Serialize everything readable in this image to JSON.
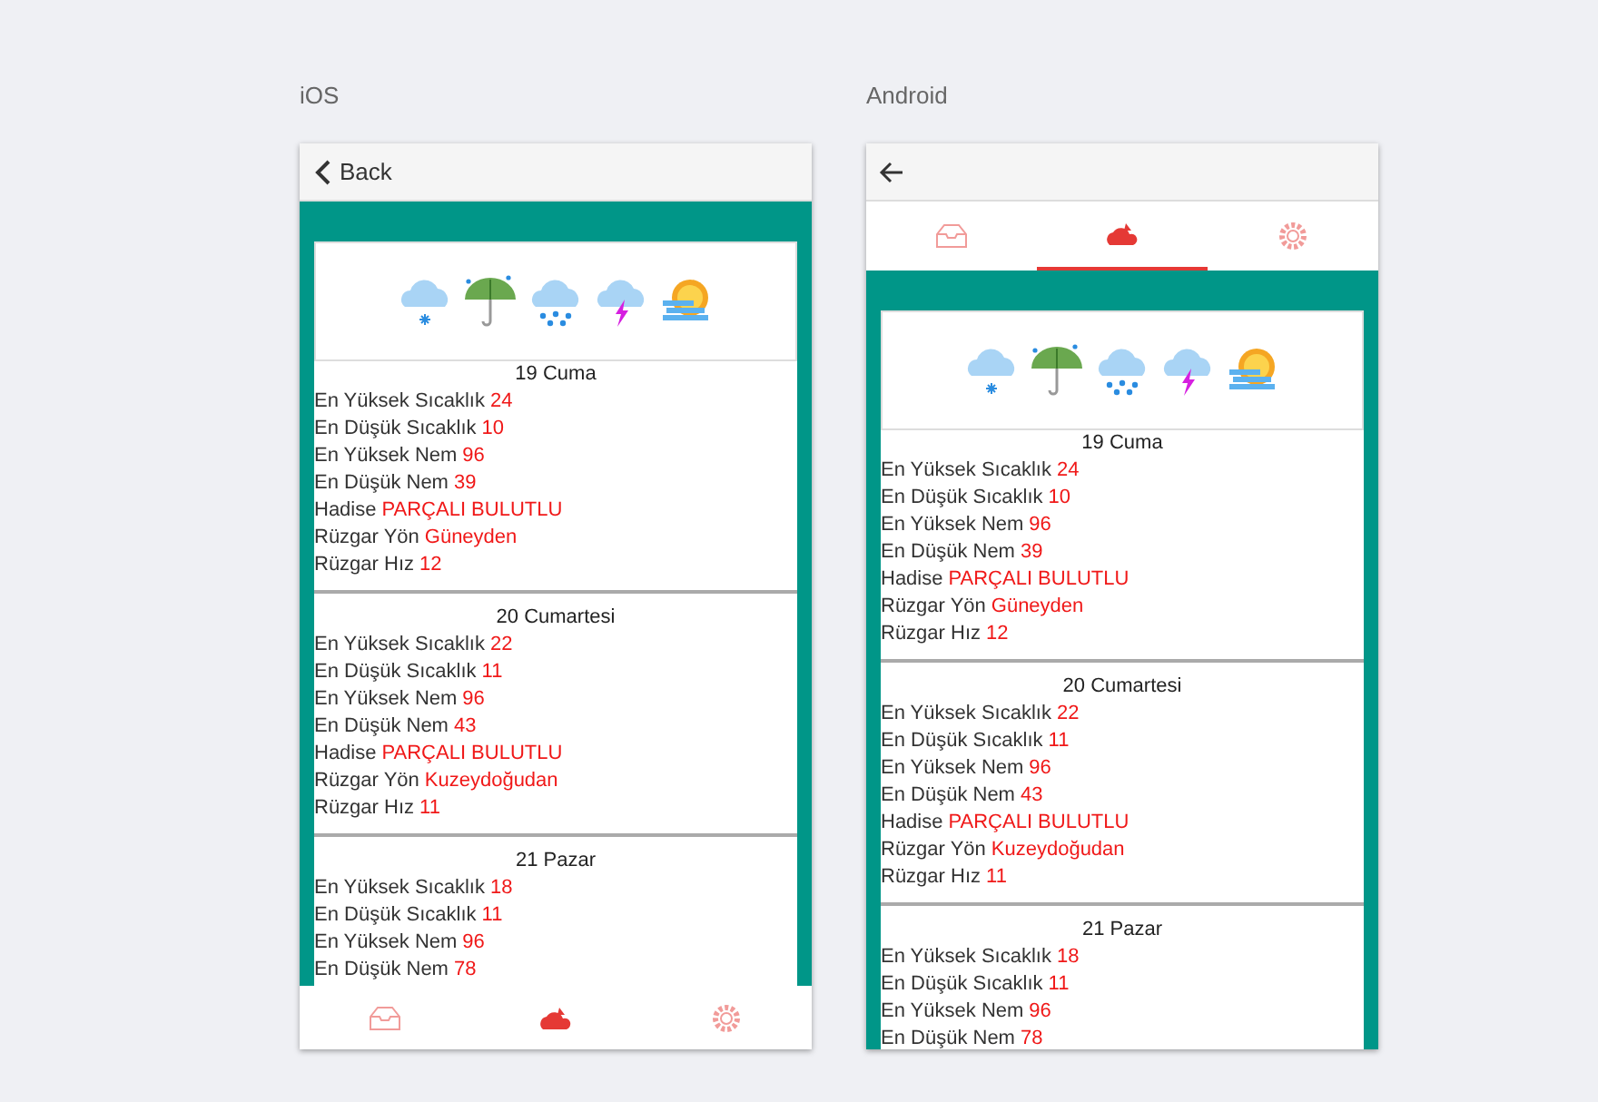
{
  "phones": [
    {
      "kind": "ios",
      "platform_label": "iOS",
      "back_label": "Back",
      "tabs": [
        {
          "selected": false
        },
        {
          "selected": true
        },
        {
          "selected": false
        }
      ],
      "days": [
        {
          "title": "19 Cuma",
          "rows": [
            {
              "label": "En Yüksek Sıcaklık",
              "value": "24"
            },
            {
              "label": "En Düşük Sıcaklık",
              "value": "10"
            },
            {
              "label": "En Yüksek Nem",
              "value": "96"
            },
            {
              "label": "En Düşük Nem",
              "value": "39"
            },
            {
              "label": "Hadise",
              "value": "PARÇALI BULUTLU"
            },
            {
              "label": "Rüzgar Yön",
              "value": "Güneyden"
            },
            {
              "label": "Rüzgar Hız",
              "value": "12"
            }
          ]
        },
        {
          "title": "20 Cumartesi",
          "rows": [
            {
              "label": "En Yüksek Sıcaklık",
              "value": "22"
            },
            {
              "label": "En Düşük Sıcaklık",
              "value": "11"
            },
            {
              "label": "En Yüksek Nem",
              "value": "96"
            },
            {
              "label": "En Düşük Nem",
              "value": "43"
            },
            {
              "label": "Hadise",
              "value": "PARÇALI BULUTLU"
            },
            {
              "label": "Rüzgar Yön",
              "value": "Kuzeydoğudan"
            },
            {
              "label": "Rüzgar Hız",
              "value": "11"
            }
          ]
        },
        {
          "title": "21 Pazar",
          "rows": [
            {
              "label": "En Yüksek Sıcaklık",
              "value": "18"
            },
            {
              "label": "En Düşük Sıcaklık",
              "value": "11"
            },
            {
              "label": "En Yüksek Nem",
              "value": "96"
            },
            {
              "label": "En Düşük Nem",
              "value": "78"
            }
          ]
        }
      ]
    },
    {
      "kind": "android",
      "platform_label": "Android",
      "tabs": [
        {
          "selected": false
        },
        {
          "selected": true
        },
        {
          "selected": false
        }
      ],
      "days": [
        {
          "title": "19 Cuma",
          "rows": [
            {
              "label": "En Yüksek Sıcaklık",
              "value": "24"
            },
            {
              "label": "En Düşük Sıcaklık",
              "value": "10"
            },
            {
              "label": "En Yüksek Nem",
              "value": "96"
            },
            {
              "label": "En Düşük Nem",
              "value": "39"
            },
            {
              "label": "Hadise",
              "value": "PARÇALI BULUTLU"
            },
            {
              "label": "Rüzgar Yön",
              "value": "Güneyden"
            },
            {
              "label": "Rüzgar Hız",
              "value": "12"
            }
          ]
        },
        {
          "title": "20 Cumartesi",
          "rows": [
            {
              "label": "En Yüksek Sıcaklık",
              "value": "22"
            },
            {
              "label": "En Düşük Sıcaklık",
              "value": "11"
            },
            {
              "label": "En Yüksek Nem",
              "value": "96"
            },
            {
              "label": "En Düşük Nem",
              "value": "43"
            },
            {
              "label": "Hadise",
              "value": "PARÇALI BULUTLU"
            },
            {
              "label": "Rüzgar Yön",
              "value": "Kuzeydoğudan"
            },
            {
              "label": "Rüzgar Hız",
              "value": "11"
            }
          ]
        },
        {
          "title": "21 Pazar",
          "rows": [
            {
              "label": "En Yüksek Sıcaklık",
              "value": "18"
            },
            {
              "label": "En Düşük Sıcaklık",
              "value": "11"
            },
            {
              "label": "En Yüksek Nem",
              "value": "96"
            },
            {
              "label": "En Düşük Nem",
              "value": "78"
            }
          ]
        }
      ]
    }
  ]
}
